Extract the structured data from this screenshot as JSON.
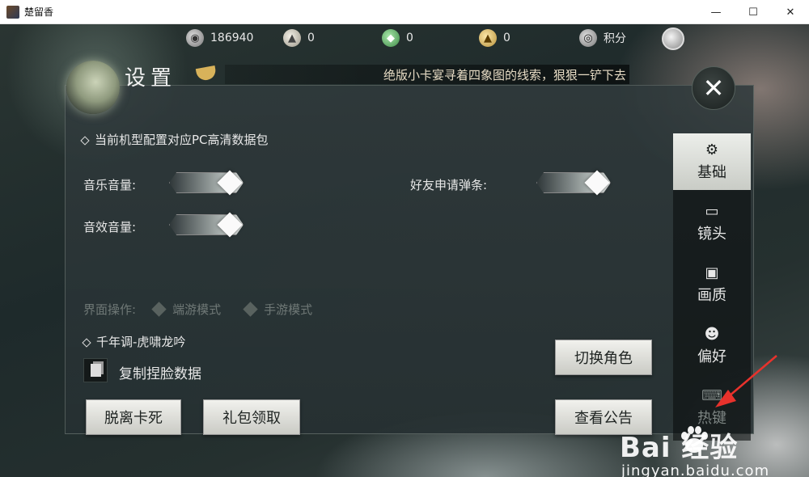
{
  "window": {
    "title": "楚留香",
    "minimize": "—",
    "maximize": "☐",
    "close": "✕"
  },
  "resources": {
    "coins": "186940",
    "ingots": "0",
    "jade": "0",
    "gold": "0",
    "points_label": "积分"
  },
  "panel": {
    "title": "设置",
    "marquee": "绝版小卡宴寻着四象图的线索，狠狠一铲下去",
    "close_label": "✕"
  },
  "settings": {
    "hd_pack": "当前机型配置对应PC高清数据包",
    "music_volume_label": "音乐音量:",
    "sfx_volume_label": "音效音量:",
    "friend_popup_label": "好友申请弹条:",
    "music_volume": 1.0,
    "sfx_volume": 1.0,
    "friend_popup": 1.0,
    "ui_mode_label": "界面操作:",
    "mode_pc": "端游模式",
    "mode_mobile": "手游模式",
    "music_track": "千年调-虎啸龙吟",
    "copy_face_label": "复制捏脸数据"
  },
  "buttons": {
    "switch_role": "切换角色",
    "unstuck": "脱离卡死",
    "gift_claim": "礼包领取",
    "announcement": "查看公告"
  },
  "tabs": [
    {
      "label": "基础",
      "icon": "gear-icon"
    },
    {
      "label": "镜头",
      "icon": "camera-icon"
    },
    {
      "label": "画质",
      "icon": "monitor-icon"
    },
    {
      "label": "偏好",
      "icon": "user-settings-icon"
    },
    {
      "label": "热键",
      "icon": "keyboard-icon"
    }
  ],
  "watermark": {
    "brand": "Bai  经验",
    "url": "jingyan.baidu.com"
  },
  "colors": {
    "annotation_arrow": "#e8322c",
    "active_tab": "#e6e8e4"
  }
}
